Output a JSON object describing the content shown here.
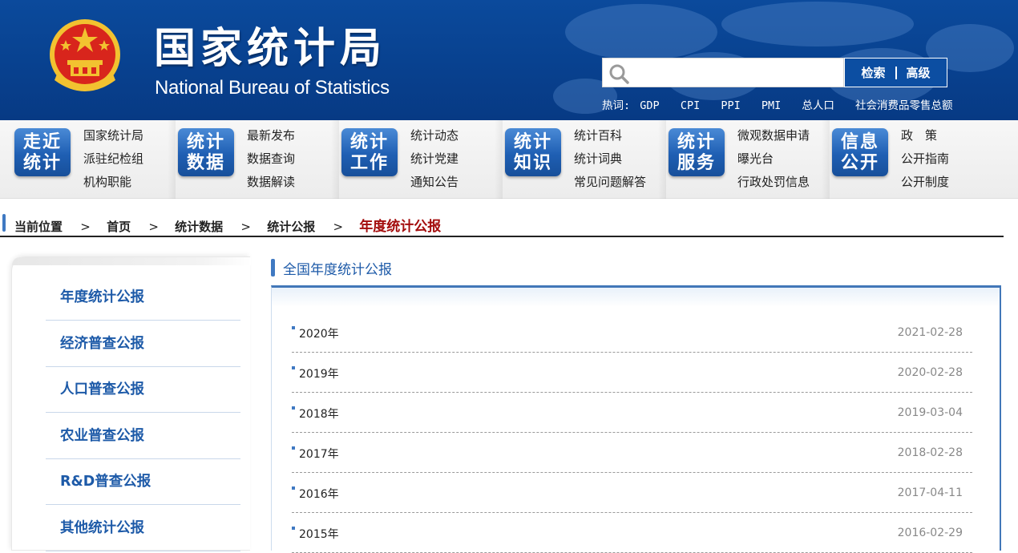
{
  "header": {
    "title_cn": "国家统计局",
    "title_en": "National Bureau of Statistics",
    "search": {
      "placeholder": "",
      "search_label": "检索",
      "advanced_label": "高级"
    },
    "hotwords_label": "热词:",
    "hotwords": [
      "GDP",
      "CPI",
      "PPI",
      "PMI",
      "总人口",
      "社会消费品零售总额"
    ]
  },
  "nav": [
    {
      "icon_lines": [
        "走近",
        "统计"
      ],
      "links": [
        "国家统计局",
        "派驻纪检组",
        "机构职能"
      ]
    },
    {
      "icon_lines": [
        "统计",
        "数据"
      ],
      "links": [
        "最新发布",
        "数据查询",
        "数据解读"
      ]
    },
    {
      "icon_lines": [
        "统计",
        "工作"
      ],
      "links": [
        "统计动态",
        "统计党建",
        "通知公告"
      ]
    },
    {
      "icon_lines": [
        "统计",
        "知识"
      ],
      "links": [
        "统计百科",
        "统计词典",
        "常见问题解答"
      ]
    },
    {
      "icon_lines": [
        "统计",
        "服务"
      ],
      "links": [
        "微观数据申请",
        "曝光台",
        "行政处罚信息"
      ]
    },
    {
      "icon_lines": [
        "信息",
        "公开"
      ],
      "links": [
        "政　策",
        "公开指南",
        "公开制度"
      ]
    }
  ],
  "breadcrumb": {
    "label": "当前位置",
    "items": [
      "首页",
      "统计数据",
      "统计公报"
    ],
    "current": "年度统计公报",
    "separator": ">"
  },
  "sidebar": {
    "items": [
      "年度统计公报",
      "经济普查公报",
      "人口普查公报",
      "农业普查公报",
      "R&D普查公报",
      "其他统计公报"
    ]
  },
  "main": {
    "title": "全国年度统计公报",
    "rows": [
      {
        "name": "2020年",
        "date": "2021-02-28"
      },
      {
        "name": "2019年",
        "date": "2020-02-28"
      },
      {
        "name": "2018年",
        "date": "2019-03-04"
      },
      {
        "name": "2017年",
        "date": "2018-02-28"
      },
      {
        "name": "2016年",
        "date": "2017-04-11"
      },
      {
        "name": "2015年",
        "date": "2016-02-29"
      }
    ]
  },
  "colors": {
    "header_blue": "#0b4a9c",
    "link_blue": "#1d5aa8",
    "breadcrumb_current": "#a30c0c"
  }
}
